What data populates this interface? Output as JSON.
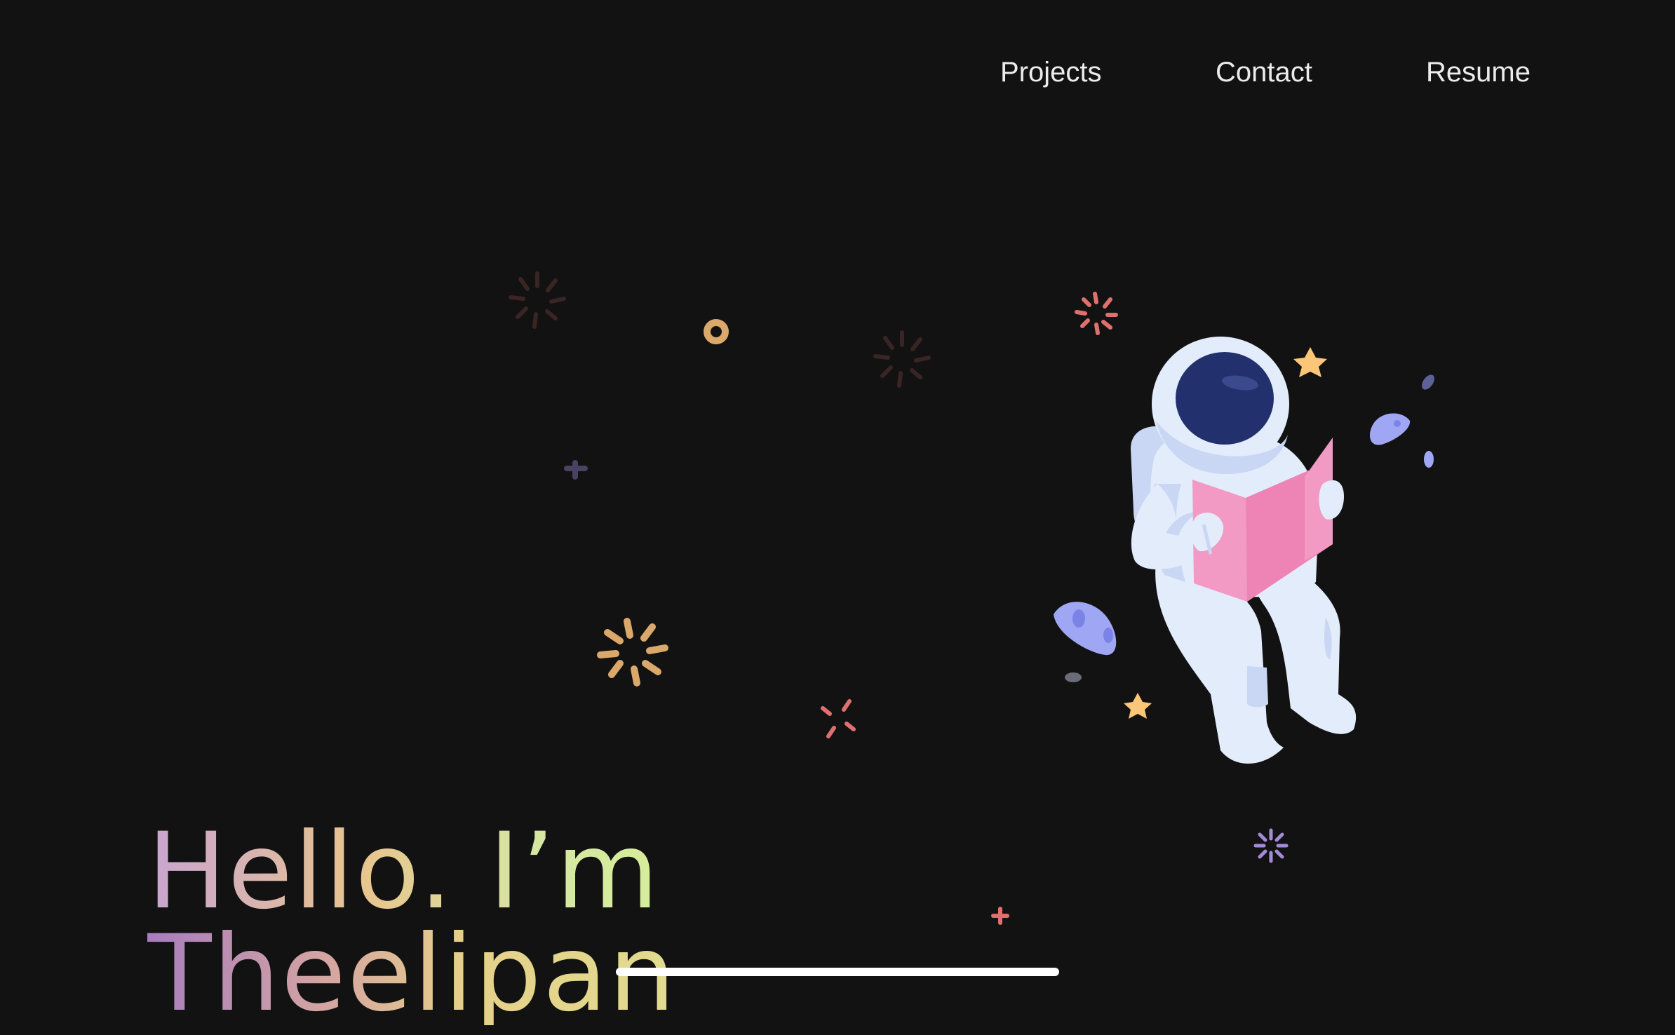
{
  "nav": {
    "items": [
      {
        "label": "Projects"
      },
      {
        "label": "Contact"
      },
      {
        "label": "Resume"
      }
    ]
  },
  "hero": {
    "greeting": "Hello. I’m",
    "name": "Theelipan"
  },
  "illustration": {
    "subject": "astronaut-reading-book",
    "colors": {
      "suit": "#e3ecfb",
      "visor": "#23306e",
      "book": "#f29ac4",
      "star": "#fcc678",
      "rock": "#9fa7f4",
      "spark_red": "#e0706e",
      "spark_gold": "#d9a86a",
      "spark_purple": "#a48bd8"
    }
  },
  "colors": {
    "background": "#121212",
    "nav_text": "#ececec"
  }
}
